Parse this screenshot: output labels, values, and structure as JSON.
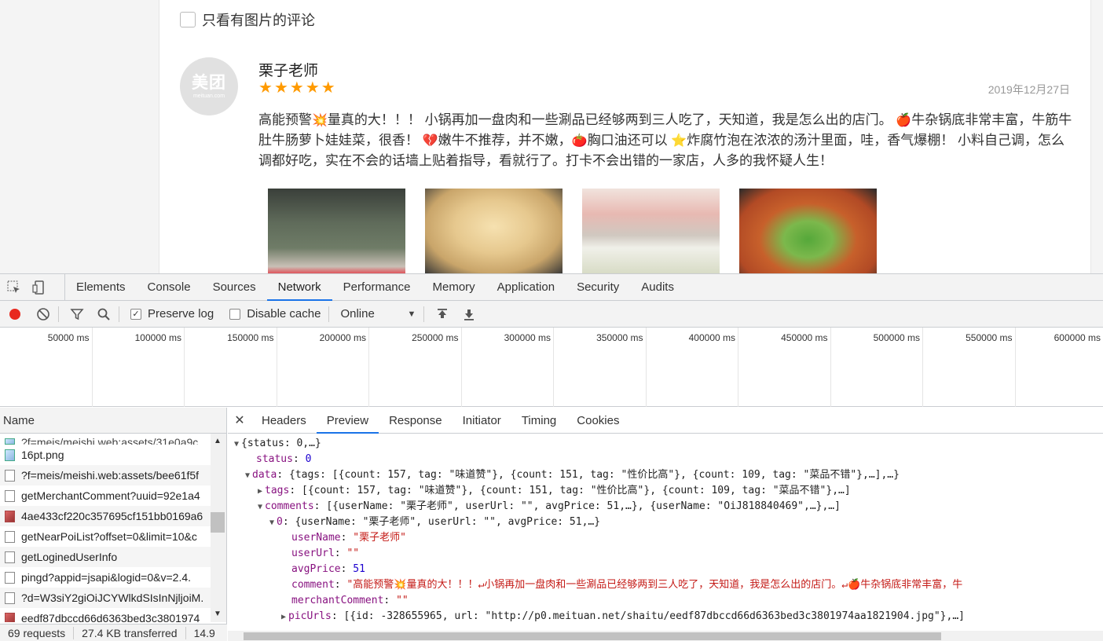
{
  "page": {
    "filter_label": "只看有图片的评论",
    "avatar_logo": "美团",
    "avatar_sub": "meituan.com",
    "review": {
      "user": "栗子老师",
      "stars": 5,
      "date": "2019年12月27日",
      "text_parts": [
        "高能预警",
        "量真的大！！！ 小锅再加一盘肉和一些涮品已经够两到三人吃了，天知道，我是怎么出的店门。 ",
        "牛杂锅底非常丰富，牛筋牛肚牛肠萝卜娃娃菜，很香！ ",
        "嫩牛不推荐，并不嫩，",
        "胸口油还可以 ",
        "炸腐竹泡在浓浓的汤汁里面，哇，香气爆棚！ 小料自己调，怎么调都好吃，实在不会的话墙上贴着指导，看就行了。打卡不会出错的一家店，人多的我怀疑人生！"
      ],
      "emojis": [
        "💥",
        "🍎",
        "💔",
        "🍅",
        "⭐"
      ]
    }
  },
  "devtools": {
    "tabs": [
      "Elements",
      "Console",
      "Sources",
      "Network",
      "Performance",
      "Memory",
      "Application",
      "Security",
      "Audits"
    ],
    "active_tab": "Network",
    "toolbar": {
      "preserve_log": "Preserve log",
      "disable_cache": "Disable cache",
      "throttle": "Online"
    },
    "timeline_ticks": [
      "50000 ms",
      "100000 ms",
      "150000 ms",
      "200000 ms",
      "250000 ms",
      "300000 ms",
      "350000 ms",
      "400000 ms",
      "450000 ms",
      "500000 ms",
      "550000 ms",
      "600000 ms"
    ],
    "requests_header": "Name",
    "requests": [
      {
        "name": "?f=meis/meishi.web:assets/31e0a9c",
        "icon": "img"
      },
      {
        "name": "16pt.png",
        "icon": "img"
      },
      {
        "name": "?f=meis/meishi.web:assets/bee61f5f",
        "icon": "doc"
      },
      {
        "name": "getMerchantComment?uuid=92e1a4",
        "icon": "doc"
      },
      {
        "name": "4ae433cf220c357695cf151bb0169a6",
        "icon": "imgred"
      },
      {
        "name": "getNearPoiList?offset=0&limit=10&c",
        "icon": "doc"
      },
      {
        "name": "getLoginedUserInfo",
        "icon": "doc"
      },
      {
        "name": "pingd?appid=jsapi&logid=0&v=2.4.",
        "icon": "doc"
      },
      {
        "name": "?d=W3siY2giOiJCYWlkdSIsInNjljoiM.",
        "icon": "doc"
      },
      {
        "name": "eedf87dbccd66d6363bed3c3801974",
        "icon": "imgred"
      }
    ],
    "status": {
      "requests": "69 requests",
      "transferred": "27.4 KB transferred",
      "extra": "14.9"
    },
    "detail_tabs": [
      "Headers",
      "Preview",
      "Response",
      "Initiator",
      "Timing",
      "Cookies"
    ],
    "detail_active": "Preview",
    "preview": {
      "l1": "{status: 0,…}",
      "status_key": "status",
      "status_val": "0",
      "data_key": "data",
      "data_summary": "{tags: [{count: 157, tag: \"味道赞\"}, {count: 151, tag: \"性价比高\"}, {count: 109, tag: \"菜品不错\"},…],…}",
      "tags_key": "tags",
      "tags_summary": "[{count: 157, tag: \"味道赞\"}, {count: 151, tag: \"性价比高\"}, {count: 109, tag: \"菜品不错\"},…]",
      "comments_key": "comments",
      "comments_summary": "[{userName: \"栗子老师\", userUrl: \"\", avgPrice: 51,…}, {userName: \"OiJ818840469\",…},…]",
      "item0_key": "0",
      "item0_summary": "{userName: \"栗子老师\", userUrl: \"\", avgPrice: 51,…}",
      "userName_key": "userName",
      "userName_val": "\"栗子老师\"",
      "userUrl_key": "userUrl",
      "userUrl_val": "\"\"",
      "avgPrice_key": "avgPrice",
      "avgPrice_val": "51",
      "comment_key": "comment",
      "comment_val": "\"高能预警💥量真的大！！！↵小锅再加一盘肉和一些涮品已经够两到三人吃了，天知道，我是怎么出的店门。↵🍎牛杂锅底非常丰富，牛",
      "merchant_key": "merchantComment",
      "merchant_val": "\"\"",
      "picUrls_key": "picUrls",
      "picUrls_summary": "[{id: -328655965, url: \"http://p0.meituan.net/shaitu/eedf87dbccd66d6363bed3c3801974aa1821904.jpg\"},…]"
    }
  }
}
